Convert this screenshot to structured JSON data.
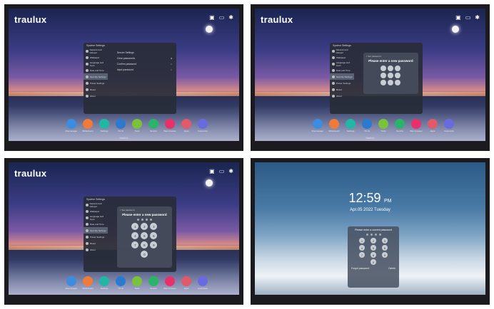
{
  "brand": "traulux",
  "bezel_label": "traulux",
  "settings_title": "System Settings",
  "sidebar": [
    "Network and Hotspot",
    "Wallpaper",
    "Language and Input",
    "Date and Time",
    "Security Settings",
    "Power Settings",
    "Reset",
    "About"
  ],
  "screen1": {
    "section_title": "Secure Settings",
    "options": [
      "Clear passwords",
      "Confirm password",
      "Input password"
    ]
  },
  "screen2": {
    "back": "< Set password",
    "prompt": "Please enter a new password"
  },
  "screen3": {
    "back": "< Set password",
    "prompt": "Please enter a new password"
  },
  "screen4": {
    "time": "12:59",
    "ampm": "PM",
    "date": "Apr.05 2022 Tuesday",
    "prompt": "Please enter a current password",
    "forgot": "Forgot password",
    "delete": "Delete"
  },
  "dock": [
    "Filemanager",
    "Whiteboard",
    "Settings",
    "Tfx UI",
    "Tools",
    "Source",
    "Web browser",
    "Apps",
    "Customize"
  ],
  "dock_colors": [
    "#3c8ce0",
    "#f07a3a",
    "#22b6a6",
    "#2a7ad0",
    "#7ac23a",
    "#2ab46a",
    "#e8306a",
    "#e05a6a",
    "#6a6ae0"
  ],
  "keys": [
    "1",
    "2",
    "3",
    "4",
    "5",
    "6",
    "7",
    "8",
    "9",
    "0"
  ]
}
